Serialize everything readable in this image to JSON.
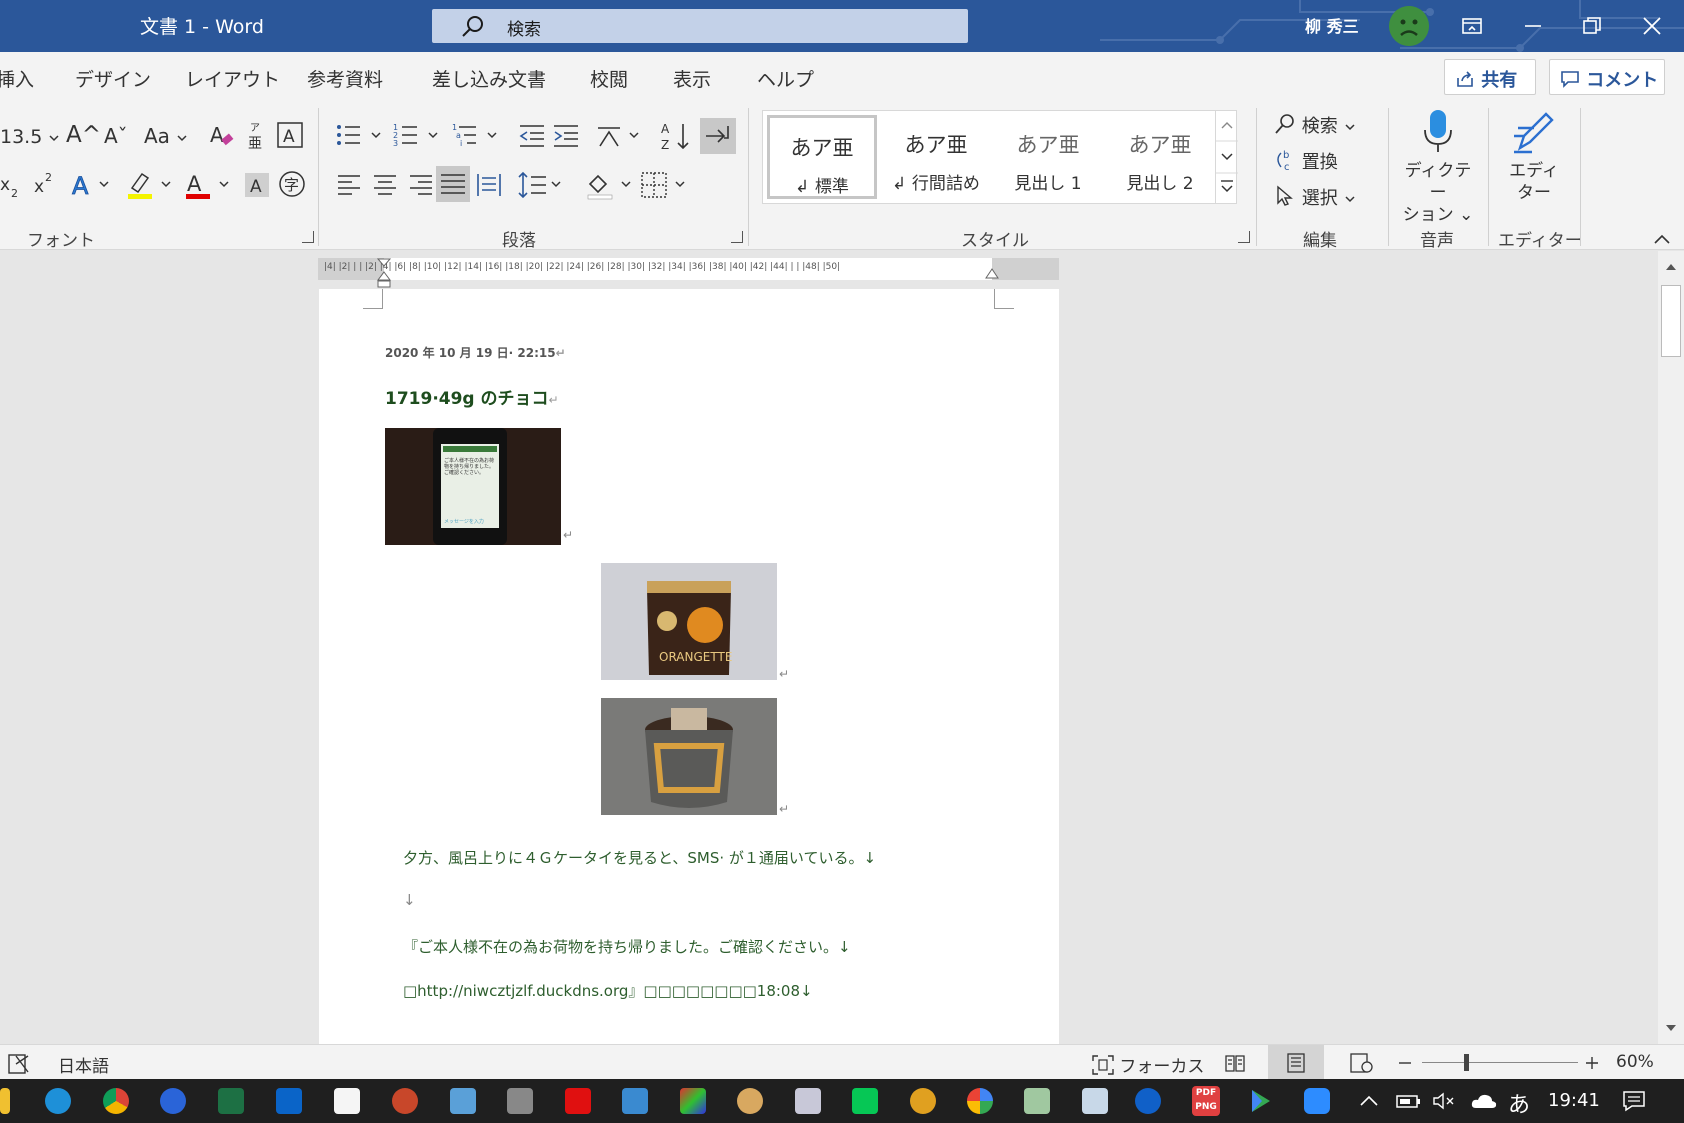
{
  "titlebar": {
    "title": "文書 1  -  Word",
    "search_placeholder": "検索",
    "user_name": "柳 秀三",
    "window_buttons": [
      "ribbon-display-icon",
      "minimize-icon",
      "restore-icon",
      "close-icon"
    ]
  },
  "tabs": [
    "挿入",
    "デザイン",
    "レイアウト",
    "参考資料",
    "差し込み文書",
    "校閲",
    "表示",
    "ヘルプ"
  ],
  "share_label": "共有",
  "comment_label": "コメント",
  "font": {
    "size": "13.5",
    "grow_glyph": "A^",
    "shrink_glyph": "Aˇ",
    "case_glyph": "Aa",
    "group_label": "フォント"
  },
  "paragraph_label": "段落",
  "styles": {
    "group_label": "スタイル",
    "items": [
      {
        "preview": "あア亜",
        "name": "標準"
      },
      {
        "preview": "あア亜",
        "name": "行間詰め"
      },
      {
        "preview": "あア亜",
        "name": "見出し 1"
      },
      {
        "preview": "あア亜",
        "name": "見出し 2"
      }
    ]
  },
  "editing": {
    "find": "検索",
    "replace": "置換",
    "select": "選択",
    "group_label": "編集"
  },
  "dictation": {
    "label_line1": "ディクテー",
    "label_line2": "ション",
    "group_label": "音声"
  },
  "editor": {
    "label_line1": "エディ",
    "label_line2": "ター",
    "group_label": "エディター"
  },
  "ruler_ticks": "|4|  |2|  |  |  |2|  |4|  |6|  |8|  |10|  |12|  |14|  |16|  |18|  |20|  |22|  |24|  |26|  |28|  |30|  |32|  |34|  |36|  |38|  |40|  |42|  |44|  |  |  |48|  |50|",
  "document": {
    "date_line": "2020 年 10 月 19 日· 22:15",
    "title": "1719·49g のチョコ",
    "phone_screen": {
      "sms_text": "ご本人様不在の為お荷物を持ち帰りました。ご確認ください。",
      "input_hint": "メッセージを入力"
    },
    "package_label": "ORANGETTE",
    "paragraphs": [
      "夕方、風呂上りに４Ｇケータイを見ると、SMS· が１通届いている。↓",
      "↓",
      "『ご本人様不在の為お荷物を持ち帰りました。ご確認ください。↓",
      "□http://niwcztjzlf.duckdns.org』□□□□□□□□18:08↓"
    ]
  },
  "statusbar": {
    "language": "日本語",
    "focus": "フォーカス",
    "zoom": "60%"
  },
  "taskbar": {
    "ime": "あ",
    "time": "19:41",
    "pdf_label": "PDF PNG"
  },
  "colors": {
    "word_blue": "#2b579a",
    "doc_text_green": "#2e5e2e",
    "taskbar": "#1f1f1f"
  }
}
